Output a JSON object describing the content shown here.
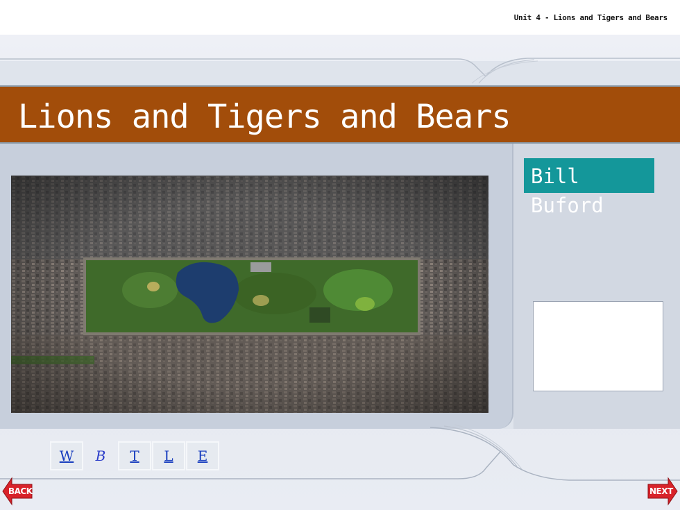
{
  "header": {
    "unit_label": "Unit 4 - Lions and Tigers and Bears"
  },
  "title": {
    "text": "Lions and Tigers and Bears"
  },
  "author": {
    "first": "Bill",
    "last": "Buford"
  },
  "photo": {
    "description_icon": "aerial-park-photo"
  },
  "nav": {
    "items": [
      {
        "label": "W",
        "active": false
      },
      {
        "label": "B",
        "active": true
      },
      {
        "label": "T",
        "active": false
      },
      {
        "label": "L",
        "active": false
      },
      {
        "label": "E",
        "active": false
      }
    ]
  },
  "footer": {
    "back_label": "BACK",
    "next_label": "NEXT"
  },
  "colors": {
    "title_bar": "#a24d0a",
    "author_bg": "#14979a",
    "arrow_red": "#d8232a",
    "link_blue": "#1a3fbf"
  }
}
